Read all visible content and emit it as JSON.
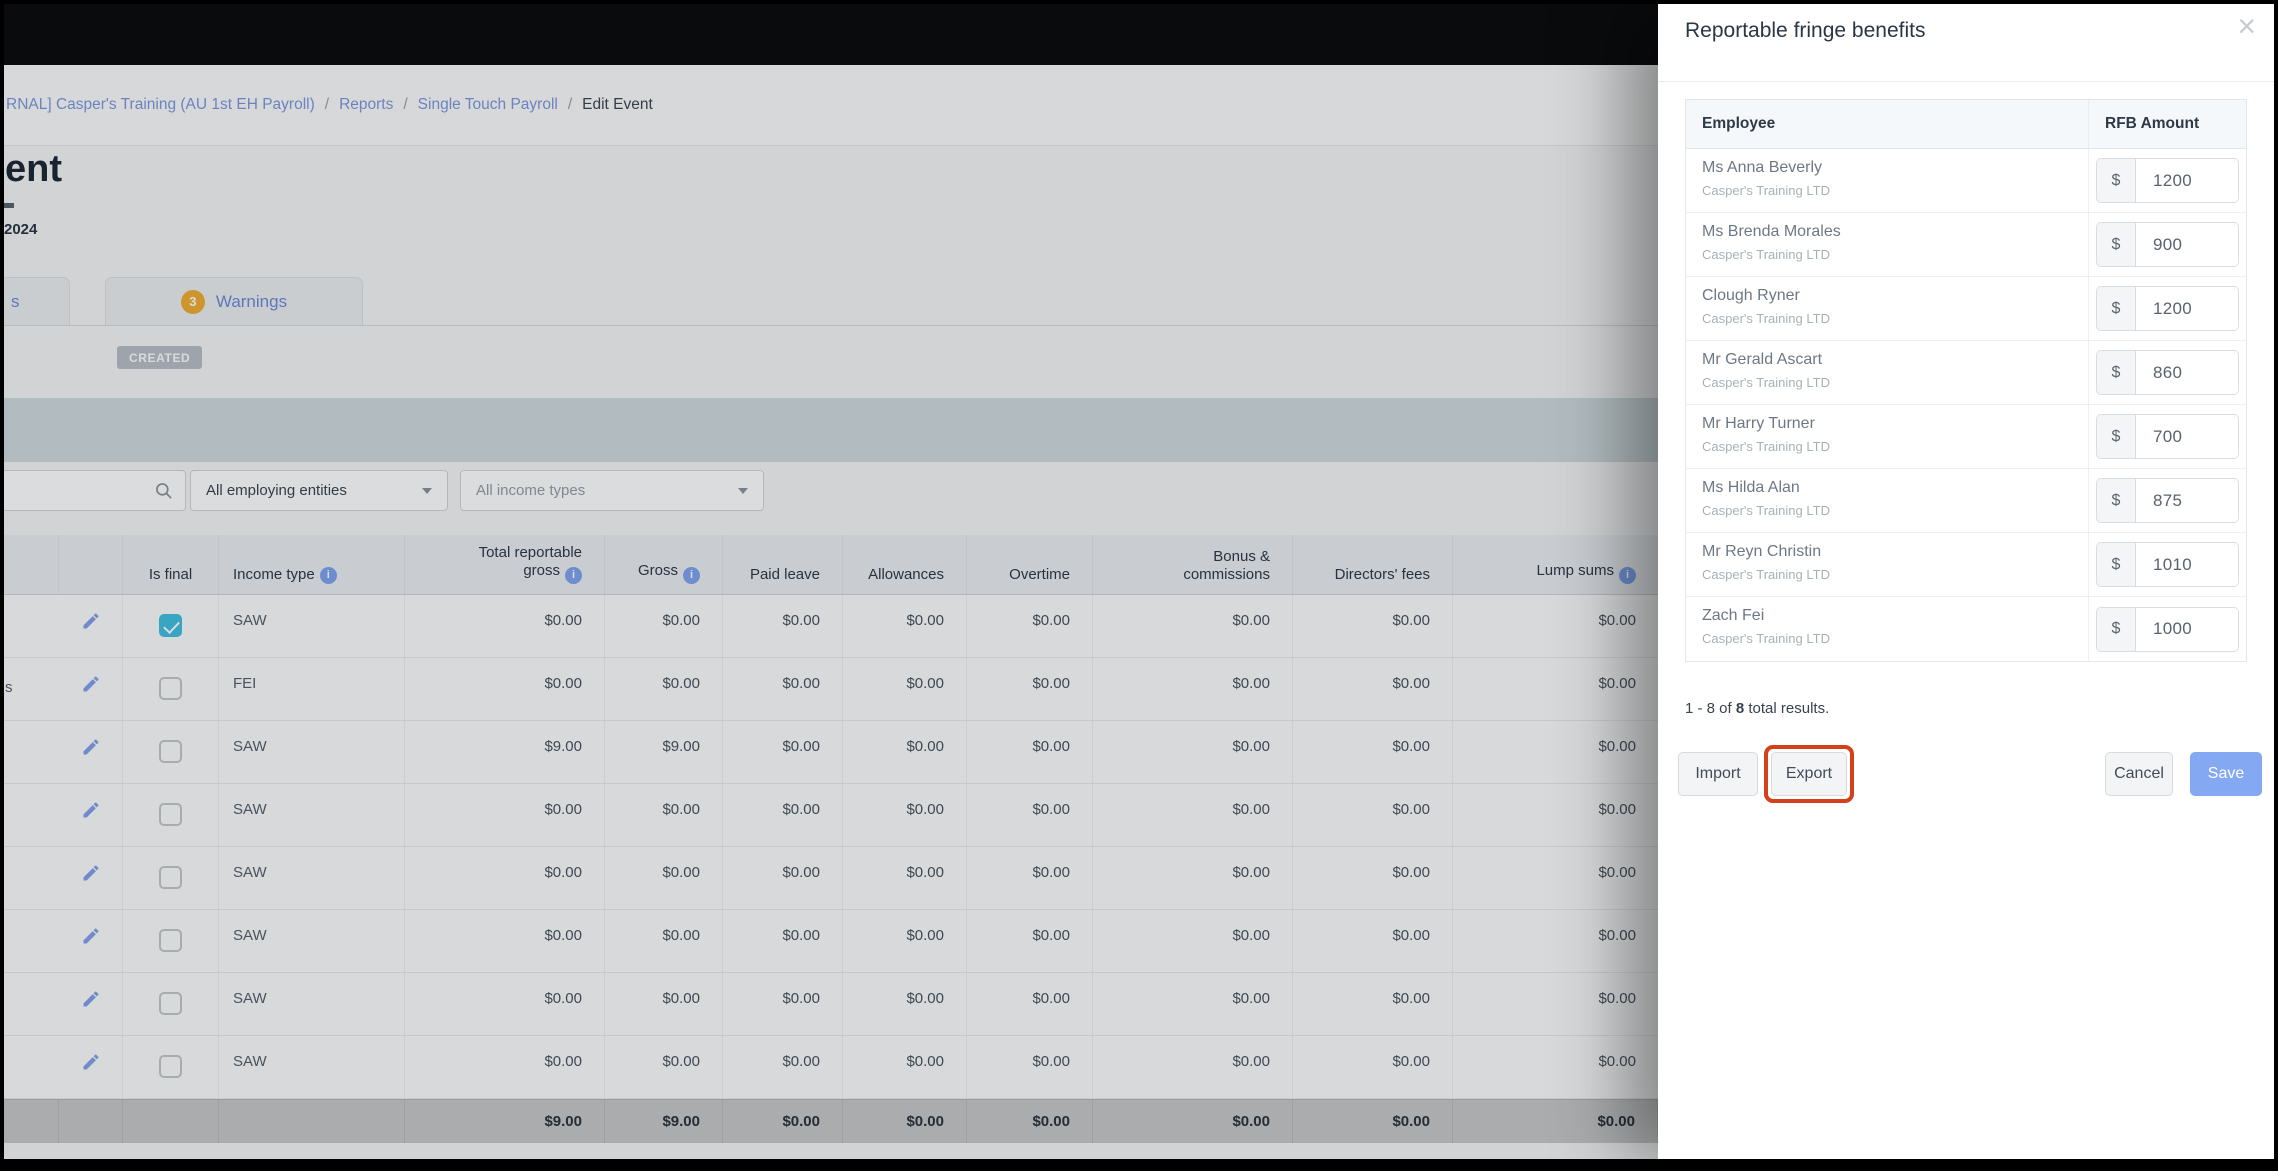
{
  "breadcrumb": {
    "separator": "/",
    "items": [
      {
        "label": "RNAL] Casper's Training (AU 1st EH Payroll)"
      },
      {
        "label": "Reports"
      },
      {
        "label": "Single Touch Payroll"
      },
      {
        "label": "Edit Event"
      }
    ]
  },
  "page": {
    "title_fragment": "ent",
    "date_fragment": "2024",
    "tab_fragment": "s",
    "warnings_tab": {
      "count": "3",
      "label": "Warnings"
    },
    "status_badge": "CREATED"
  },
  "filters": {
    "employing_entities": "All employing entities",
    "income_types": "All income types"
  },
  "main_table": {
    "headers": {
      "is_final": "Is final",
      "income_type": "Income type",
      "total_reportable_gross": "Total reportable gross",
      "gross": "Gross",
      "paid_leave": "Paid leave",
      "allowances": "Allowances",
      "overtime": "Overtime",
      "bonus_commissions": "Bonus & commissions",
      "directors_fees": "Directors' fees",
      "lump_sums": "Lump sums"
    },
    "rows": [
      {
        "name_fragment": "",
        "is_final": true,
        "income_type": "SAW",
        "values": [
          "$0.00",
          "$0.00",
          "$0.00",
          "$0.00",
          "$0.00",
          "$0.00",
          "$0.00",
          "$0.00"
        ]
      },
      {
        "name_fragment": "s",
        "is_final": false,
        "income_type": "FEI",
        "values": [
          "$0.00",
          "$0.00",
          "$0.00",
          "$0.00",
          "$0.00",
          "$0.00",
          "$0.00",
          "$0.00"
        ]
      },
      {
        "name_fragment": "",
        "is_final": false,
        "income_type": "SAW",
        "values": [
          "$9.00",
          "$9.00",
          "$0.00",
          "$0.00",
          "$0.00",
          "$0.00",
          "$0.00",
          "$0.00"
        ]
      },
      {
        "name_fragment": "",
        "is_final": false,
        "income_type": "SAW",
        "values": [
          "$0.00",
          "$0.00",
          "$0.00",
          "$0.00",
          "$0.00",
          "$0.00",
          "$0.00",
          "$0.00"
        ]
      },
      {
        "name_fragment": "",
        "is_final": false,
        "income_type": "SAW",
        "values": [
          "$0.00",
          "$0.00",
          "$0.00",
          "$0.00",
          "$0.00",
          "$0.00",
          "$0.00",
          "$0.00"
        ]
      },
      {
        "name_fragment": "",
        "is_final": false,
        "income_type": "SAW",
        "values": [
          "$0.00",
          "$0.00",
          "$0.00",
          "$0.00",
          "$0.00",
          "$0.00",
          "$0.00",
          "$0.00"
        ]
      },
      {
        "name_fragment": "",
        "is_final": false,
        "income_type": "SAW",
        "values": [
          "$0.00",
          "$0.00",
          "$0.00",
          "$0.00",
          "$0.00",
          "$0.00",
          "$0.00",
          "$0.00"
        ]
      },
      {
        "name_fragment": "",
        "is_final": false,
        "income_type": "SAW",
        "values": [
          "$0.00",
          "$0.00",
          "$0.00",
          "$0.00",
          "$0.00",
          "$0.00",
          "$0.00",
          "$0.00"
        ]
      }
    ],
    "totals": [
      "$9.00",
      "$9.00",
      "$0.00",
      "$0.00",
      "$0.00",
      "$0.00",
      "$0.00",
      "$0.00"
    ]
  },
  "modal": {
    "title": "Reportable fringe benefits",
    "close_glyph": "×",
    "table": {
      "headers": {
        "employee": "Employee",
        "rfb_amount": "RFB Amount"
      },
      "currency": "$",
      "rows": [
        {
          "name": "Ms Anna Beverly",
          "company": "Casper's Training LTD",
          "amount": "1200"
        },
        {
          "name": "Ms Brenda Morales",
          "company": "Casper's Training LTD",
          "amount": "900"
        },
        {
          "name": "Clough Ryner",
          "company": "Casper's Training LTD",
          "amount": "1200"
        },
        {
          "name": "Mr Gerald Ascart",
          "company": "Casper's Training LTD",
          "amount": "860"
        },
        {
          "name": "Mr Harry Turner",
          "company": "Casper's Training LTD",
          "amount": "700"
        },
        {
          "name": "Ms Hilda Alan",
          "company": "Casper's Training LTD",
          "amount": "875"
        },
        {
          "name": "Mr Reyn Christin",
          "company": "Casper's Training LTD",
          "amount": "1010"
        },
        {
          "name": "Zach Fei",
          "company": "Casper's Training LTD",
          "amount": "1000"
        }
      ]
    },
    "pagination": {
      "prefix": "1 - 8 of ",
      "total": "8",
      "suffix": " total results."
    },
    "buttons": {
      "import": "Import",
      "export": "Export",
      "cancel": "Cancel",
      "save": "Save"
    }
  },
  "colors": {
    "export_highlight_ring": "#d5401b",
    "save_button": "#84a8f1",
    "checked_checkbox": "#41bfe1",
    "warning_badge": "#f0ad33",
    "link_blue": "#7e97dd"
  }
}
